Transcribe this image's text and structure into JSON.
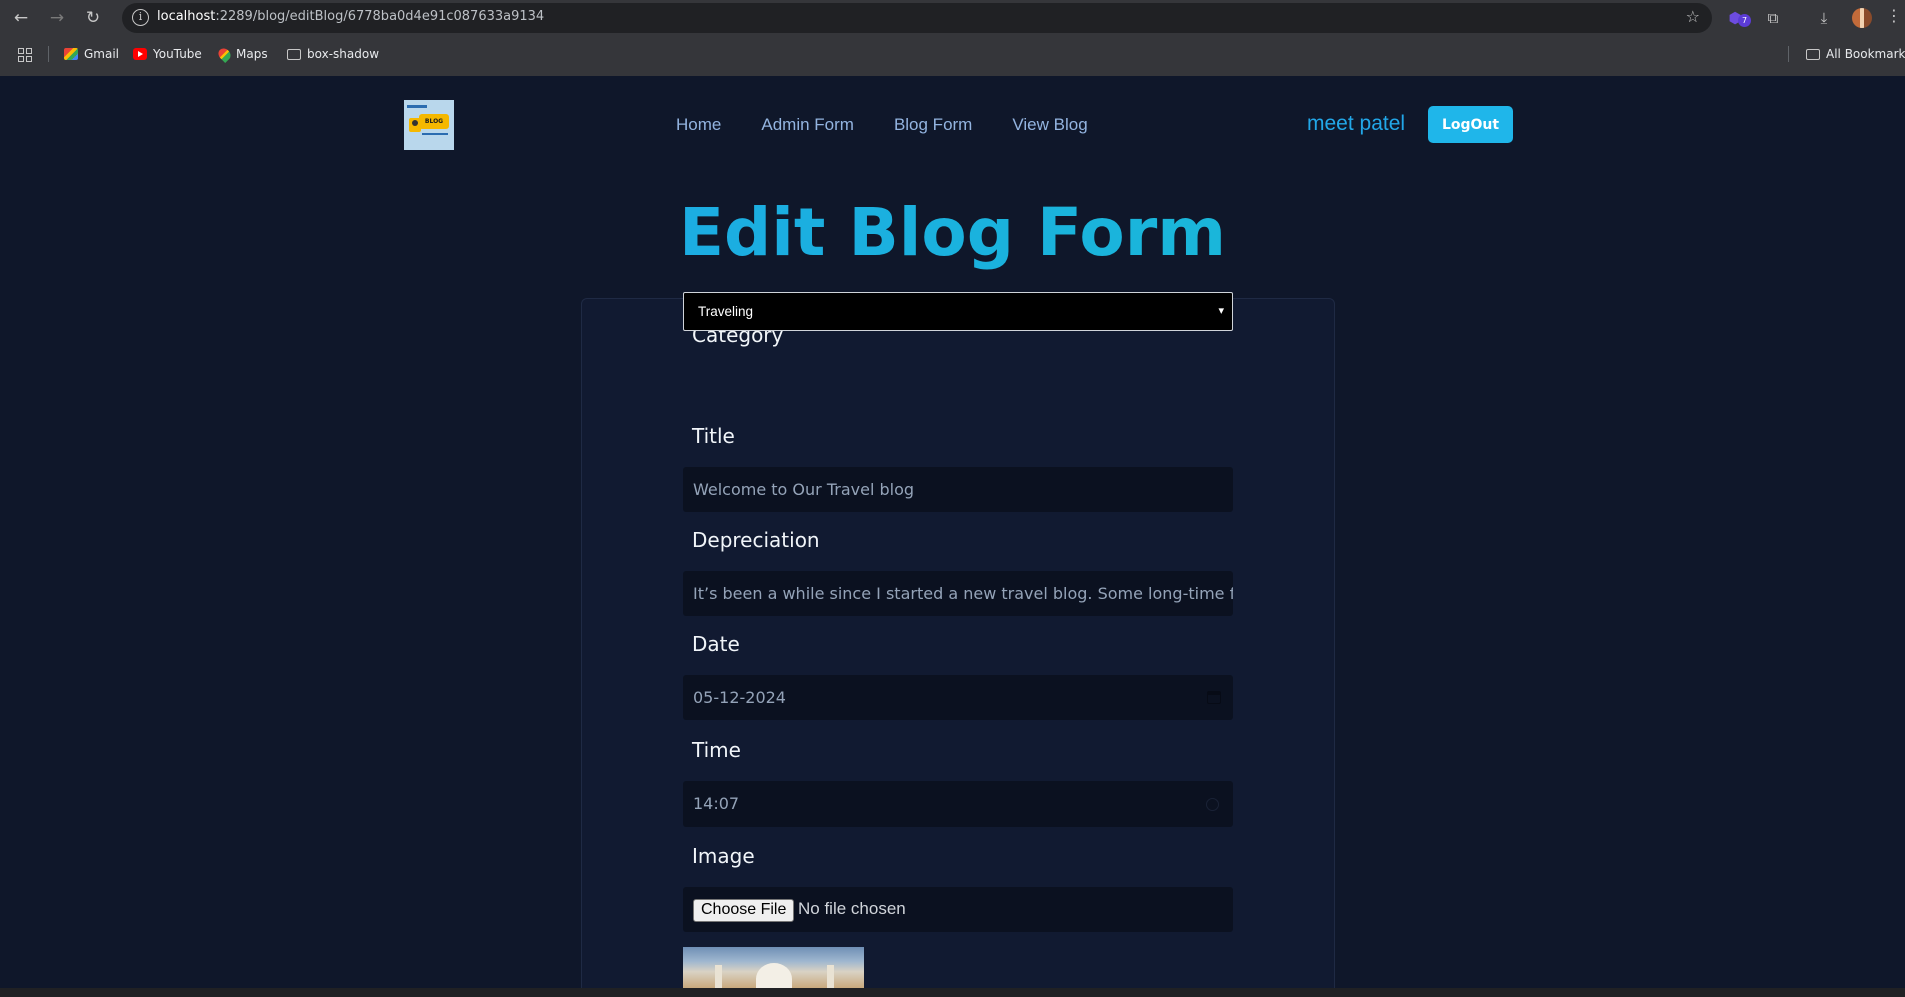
{
  "browser": {
    "url_host": "localhost",
    "url_path": ":2289/blog/editBlog/6778ba0d4e91c087633a9134",
    "extension_badge": "7",
    "bookmarks": [
      {
        "label": "Gmail",
        "icon": "gmail-icon"
      },
      {
        "label": "YouTube",
        "icon": "youtube-icon"
      },
      {
        "label": "Maps",
        "icon": "maps-icon"
      },
      {
        "label": "box-shadow",
        "icon": "folder-icon"
      }
    ],
    "all_bookmarks_label": "All Bookmarks"
  },
  "header": {
    "logo_text": "BLOG",
    "nav": [
      "Home",
      "Admin Form",
      "Blog Form",
      "View Blog"
    ],
    "username": "meet patel",
    "logout_label": "LogOut"
  },
  "form": {
    "title": "Edit Blog Form",
    "category_label": "Category",
    "category_value": "Traveling",
    "title_label": "Title",
    "title_value": "Welcome to Our Travel blog",
    "description_label": "Depreciation",
    "description_value": "It’s been a while since I started a new travel blog. Some long-time follo",
    "date_label": "Date",
    "date_value": "05-12-2024",
    "time_label": "Time",
    "time_value": "14:07",
    "image_label": "Image",
    "choose_file_label": "Choose File",
    "no_file_text": "No file chosen"
  },
  "colors": {
    "background": "#0f172a",
    "accent": "#1fb6ea",
    "title_gradient_start": "#1ea0ec",
    "title_gradient_end": "#17c3d0"
  }
}
